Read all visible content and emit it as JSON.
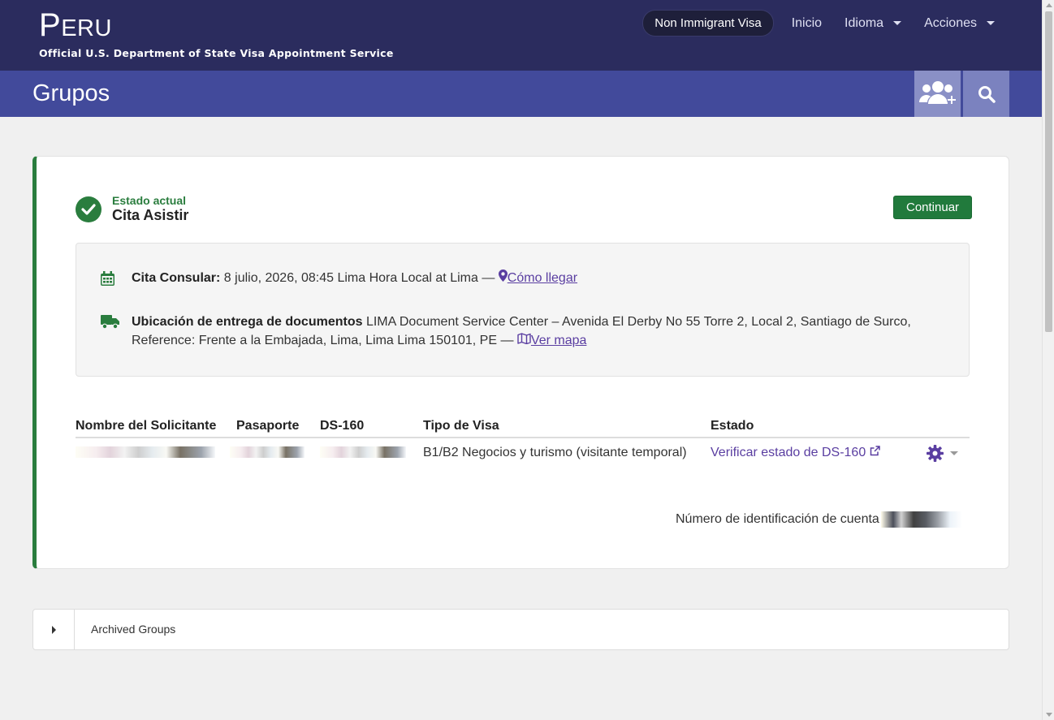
{
  "header": {
    "brand_country": "PERU",
    "brand_subtitle": "Official U.S. Department of State Visa Appointment Service",
    "nav": {
      "visa_type": "Non Immigrant Visa",
      "home": "Inicio",
      "language": "Idioma",
      "actions": "Acciones"
    }
  },
  "subheader": {
    "title": "Grupos"
  },
  "status": {
    "label": "Estado actual",
    "value": "Cita Asistir",
    "continue_label": "Continuar"
  },
  "appointment": {
    "consular_label": "Cita Consular:",
    "consular_value": "8 julio, 2026, 08:45 Lima Hora Local at Lima —",
    "directions_link": "Cómo llegar",
    "delivery_label": "Ubicación de entrega de documentos",
    "delivery_value": "LIMA Document Service Center – Avenida El Derby No 55 Torre 2, Local 2, Santiago de Surco, Reference: Frente a la Embajada, Lima, Lima Lima 150101, PE —",
    "map_link": "Ver mapa"
  },
  "table": {
    "headers": {
      "name": "Nombre del Solicitante",
      "passport": "Pasaporte",
      "ds160": "DS-160",
      "visa_type": "Tipo de Visa",
      "status": "Estado"
    },
    "rows": [
      {
        "visa_type": "B1/B2 Negocios y turismo (visitante temporal)",
        "status_link": "Verificar estado de DS-160"
      }
    ]
  },
  "account": {
    "label": "Número de identificación de cuenta"
  },
  "archived": {
    "label": "Archived Groups"
  },
  "colors": {
    "topbar": "#2b2c5e",
    "subbar": "#424a9b",
    "success": "#2a7d3e",
    "link": "#5a3ea1"
  },
  "icons": [
    "group-add-icon",
    "search-icon",
    "check-circle-icon",
    "calendar-icon",
    "map-marker-icon",
    "truck-icon",
    "map-icon",
    "external-link-icon",
    "gear-icon",
    "chevron-down-icon",
    "caret-right-icon"
  ]
}
